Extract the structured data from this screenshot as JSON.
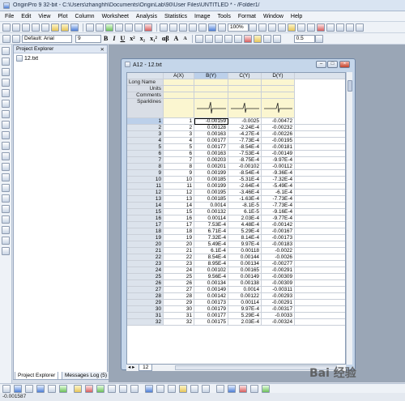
{
  "app": {
    "title": "OriginPro 9 32-bit - C:\\Users\\zhanghh\\Documents\\OriginLab\\90\\User Files\\UNTITLED * - /Folder1/"
  },
  "menu": [
    "File",
    "Edit",
    "View",
    "Plot",
    "Column",
    "Worksheet",
    "Analysis",
    "Statistics",
    "Image",
    "Tools",
    "Format",
    "Window",
    "Help"
  ],
  "toolbar": {
    "zoom": "100%",
    "font": "Default: Arial",
    "font_size": "9",
    "format_buttons": [
      "B",
      "I",
      "U",
      "x²",
      "x₂",
      "x₁²",
      "αβ",
      "A",
      "A"
    ],
    "line_width": "0.5"
  },
  "project_explorer": {
    "title": "Project Explorer",
    "pin": "⨯",
    "items": [
      "12.txt"
    ],
    "tabs": [
      "Project Explorer",
      "Messages Log (5)"
    ]
  },
  "workbook": {
    "title": "A12 - 12.txt",
    "columns": [
      "A(X)",
      "B(Y)",
      "C(Y)",
      "D(Y)"
    ],
    "meta_rows": [
      "Long Name",
      "Units",
      "Comments",
      "Sparklines"
    ],
    "sheet_tab": "12",
    "rows": [
      [
        "1",
        "1",
        "-0.00159",
        "-0.0025",
        "-0.00472"
      ],
      [
        "2",
        "2",
        "0.00128",
        "-2.24E-4",
        "-0.00232"
      ],
      [
        "3",
        "3",
        "0.00163",
        "-4.27E-4",
        "-0.00226"
      ],
      [
        "4",
        "4",
        "0.00177",
        "-7.73E-4",
        "-0.00195"
      ],
      [
        "5",
        "5",
        "0.00177",
        "-8.54E-4",
        "-0.00181"
      ],
      [
        "6",
        "6",
        "0.00163",
        "-7.53E-4",
        "-0.00149"
      ],
      [
        "7",
        "7",
        "0.00203",
        "-8.75E-4",
        "-9.97E-4"
      ],
      [
        "8",
        "8",
        "0.00201",
        "-0.00102",
        "-0.00112"
      ],
      [
        "9",
        "9",
        "0.00199",
        "-8.54E-4",
        "-9.36E-4"
      ],
      [
        "10",
        "10",
        "0.00185",
        "-5.31E-4",
        "-7.32E-4"
      ],
      [
        "11",
        "11",
        "0.00199",
        "-2.64E-4",
        "-5.49E-4"
      ],
      [
        "12",
        "12",
        "0.00195",
        "-3.46E-4",
        "-6.1E-4"
      ],
      [
        "13",
        "13",
        "0.00185",
        "-1.63E-4",
        "-7.73E-4"
      ],
      [
        "14",
        "14",
        "0.0014",
        "-8.1E-5",
        "-7.73E-4"
      ],
      [
        "15",
        "15",
        "0.00132",
        "6.1E-5",
        "-9.16E-4"
      ],
      [
        "16",
        "16",
        "0.00114",
        "2.03E-4",
        "-9.77E-4"
      ],
      [
        "17",
        "17",
        "7.53E-4",
        "4.48E-4",
        "-0.00142"
      ],
      [
        "18",
        "18",
        "6.71E-4",
        "5.29E-4",
        "-0.00167"
      ],
      [
        "19",
        "19",
        "7.32E-4",
        "8.14E-4",
        "-0.00173"
      ],
      [
        "20",
        "20",
        "5.49E-4",
        "9.97E-4",
        "-0.00183"
      ],
      [
        "21",
        "21",
        "6.1E-4",
        "0.00118",
        "-0.0022"
      ],
      [
        "22",
        "22",
        "8.54E-4",
        "0.00144",
        "-0.0026"
      ],
      [
        "23",
        "23",
        "8.95E-4",
        "0.00134",
        "-0.00277"
      ],
      [
        "24",
        "24",
        "0.00102",
        "0.00165",
        "-0.00291"
      ],
      [
        "25",
        "25",
        "9.56E-4",
        "0.00149",
        "-0.00309"
      ],
      [
        "26",
        "26",
        "0.00134",
        "0.00138",
        "-0.00309"
      ],
      [
        "27",
        "27",
        "0.00149",
        "0.0014",
        "-0.00311"
      ],
      [
        "28",
        "28",
        "0.00142",
        "0.00122",
        "-0.00293"
      ],
      [
        "29",
        "29",
        "0.00173",
        "0.00114",
        "-0.00291"
      ],
      [
        "30",
        "30",
        "0.00179",
        "9.97E-4",
        "-0.00317"
      ],
      [
        "31",
        "31",
        "0.00177",
        "5.29E-4",
        "-0.0033"
      ],
      [
        "32",
        "32",
        "0.00175",
        "2.03E-4",
        "-0.00324"
      ]
    ]
  },
  "status": {
    "value": "-0.001587"
  },
  "watermark": "Bai 经验",
  "colors": {
    "selection": "#bcd0ea",
    "meta_cell": "#fbf6d0",
    "header": "#dce3ec"
  }
}
